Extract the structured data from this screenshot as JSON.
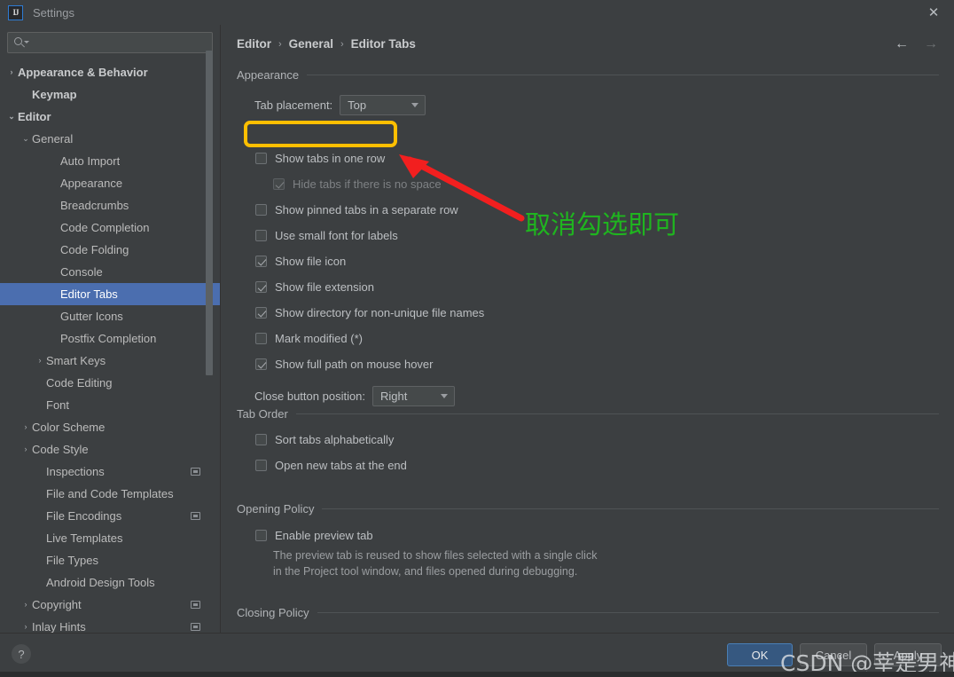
{
  "window": {
    "title": "Settings",
    "logo_text": "IJ",
    "close_icon": "✕"
  },
  "sidebar": {
    "search": {
      "placeholder": "",
      "value": "",
      "icon": "search-icon"
    },
    "items": [
      {
        "label": "Appearance & Behavior",
        "indent": 0,
        "arrow": "›",
        "bold": true,
        "selected": false,
        "badge": false
      },
      {
        "label": "Keymap",
        "indent": 1,
        "arrow": "",
        "bold": true,
        "selected": false,
        "badge": false
      },
      {
        "label": "Editor",
        "indent": 0,
        "arrow": "⌄",
        "bold": true,
        "selected": false,
        "badge": false
      },
      {
        "label": "General",
        "indent": 1,
        "arrow": "⌄",
        "bold": false,
        "selected": false,
        "badge": false
      },
      {
        "label": "Auto Import",
        "indent": 3,
        "arrow": "",
        "bold": false,
        "selected": false,
        "badge": false
      },
      {
        "label": "Appearance",
        "indent": 3,
        "arrow": "",
        "bold": false,
        "selected": false,
        "badge": false
      },
      {
        "label": "Breadcrumbs",
        "indent": 3,
        "arrow": "",
        "bold": false,
        "selected": false,
        "badge": false
      },
      {
        "label": "Code Completion",
        "indent": 3,
        "arrow": "",
        "bold": false,
        "selected": false,
        "badge": false
      },
      {
        "label": "Code Folding",
        "indent": 3,
        "arrow": "",
        "bold": false,
        "selected": false,
        "badge": false
      },
      {
        "label": "Console",
        "indent": 3,
        "arrow": "",
        "bold": false,
        "selected": false,
        "badge": false
      },
      {
        "label": "Editor Tabs",
        "indent": 3,
        "arrow": "",
        "bold": false,
        "selected": true,
        "badge": false
      },
      {
        "label": "Gutter Icons",
        "indent": 3,
        "arrow": "",
        "bold": false,
        "selected": false,
        "badge": false
      },
      {
        "label": "Postfix Completion",
        "indent": 3,
        "arrow": "",
        "bold": false,
        "selected": false,
        "badge": false
      },
      {
        "label": "Smart Keys",
        "indent": 2,
        "arrow": "›",
        "bold": false,
        "selected": false,
        "badge": false
      },
      {
        "label": "Code Editing",
        "indent": 2,
        "arrow": "",
        "bold": false,
        "selected": false,
        "badge": false
      },
      {
        "label": "Font",
        "indent": 2,
        "arrow": "",
        "bold": false,
        "selected": false,
        "badge": false
      },
      {
        "label": "Color Scheme",
        "indent": 1,
        "arrow": "›",
        "bold": false,
        "selected": false,
        "badge": false
      },
      {
        "label": "Code Style",
        "indent": 1,
        "arrow": "›",
        "bold": false,
        "selected": false,
        "badge": false
      },
      {
        "label": "Inspections",
        "indent": 2,
        "arrow": "",
        "bold": false,
        "selected": false,
        "badge": true
      },
      {
        "label": "File and Code Templates",
        "indent": 2,
        "arrow": "",
        "bold": false,
        "selected": false,
        "badge": false
      },
      {
        "label": "File Encodings",
        "indent": 2,
        "arrow": "",
        "bold": false,
        "selected": false,
        "badge": true
      },
      {
        "label": "Live Templates",
        "indent": 2,
        "arrow": "",
        "bold": false,
        "selected": false,
        "badge": false
      },
      {
        "label": "File Types",
        "indent": 2,
        "arrow": "",
        "bold": false,
        "selected": false,
        "badge": false
      },
      {
        "label": "Android Design Tools",
        "indent": 2,
        "arrow": "",
        "bold": false,
        "selected": false,
        "badge": false
      },
      {
        "label": "Copyright",
        "indent": 1,
        "arrow": "›",
        "bold": false,
        "selected": false,
        "badge": true
      },
      {
        "label": "Inlay Hints",
        "indent": 1,
        "arrow": "›",
        "bold": false,
        "selected": false,
        "badge": true
      }
    ]
  },
  "main": {
    "breadcrumb": {
      "part1": "Editor",
      "sep1": "›",
      "part2": "General",
      "sep2": "›",
      "part3": "Editor Tabs"
    },
    "nav": {
      "back_icon": "←",
      "forward_icon": "→"
    },
    "groups": {
      "appearance": "Appearance",
      "tab_order": "Tab Order",
      "opening_policy": "Opening Policy",
      "closing_policy": "Closing Policy"
    },
    "tab_placement": {
      "label": "Tab placement:",
      "value": "Top"
    },
    "close_button_position": {
      "label": "Close button position:",
      "value": "Right"
    },
    "checkboxes": {
      "show_tabs_one_row": {
        "label": "Show tabs in one row",
        "checked": false,
        "disabled": false
      },
      "hide_tabs_no_space": {
        "label": "Hide tabs if there is no space",
        "checked": true,
        "disabled": true
      },
      "pinned_separate_row": {
        "label": "Show pinned tabs in a separate row",
        "checked": false,
        "disabled": false
      },
      "small_font_labels": {
        "label": "Use small font for labels",
        "checked": false,
        "disabled": false
      },
      "show_file_icon": {
        "label": "Show file icon",
        "checked": true,
        "disabled": false
      },
      "show_file_extension": {
        "label": "Show file extension",
        "checked": true,
        "disabled": false
      },
      "show_directory": {
        "label": "Show directory for non-unique file names",
        "checked": true,
        "disabled": false
      },
      "mark_modified": {
        "label": "Mark modified (*)",
        "checked": false,
        "disabled": false
      },
      "show_full_path": {
        "label": "Show full path on mouse hover",
        "checked": true,
        "disabled": false
      },
      "sort_alphabetically": {
        "label": "Sort tabs alphabetically",
        "checked": false,
        "disabled": false
      },
      "open_new_at_end": {
        "label": "Open new tabs at the end",
        "checked": false,
        "disabled": false
      },
      "enable_preview_tab": {
        "label": "Enable preview tab",
        "checked": false,
        "disabled": false
      }
    },
    "preview_hint_line1": "The preview tab is reused to show files selected with a single click",
    "preview_hint_line2": "in the Project tool window, and files opened during debugging."
  },
  "annotations": {
    "highlight_color": "#ffbf00",
    "arrow_color": "#f21f1f",
    "text": "取消勾选即可",
    "text_color": "#1fb51f"
  },
  "footer": {
    "help_label": "?",
    "ok": "OK",
    "cancel": "Cancel",
    "apply": "Apply",
    "watermark": "CSDN @莘是男神"
  }
}
